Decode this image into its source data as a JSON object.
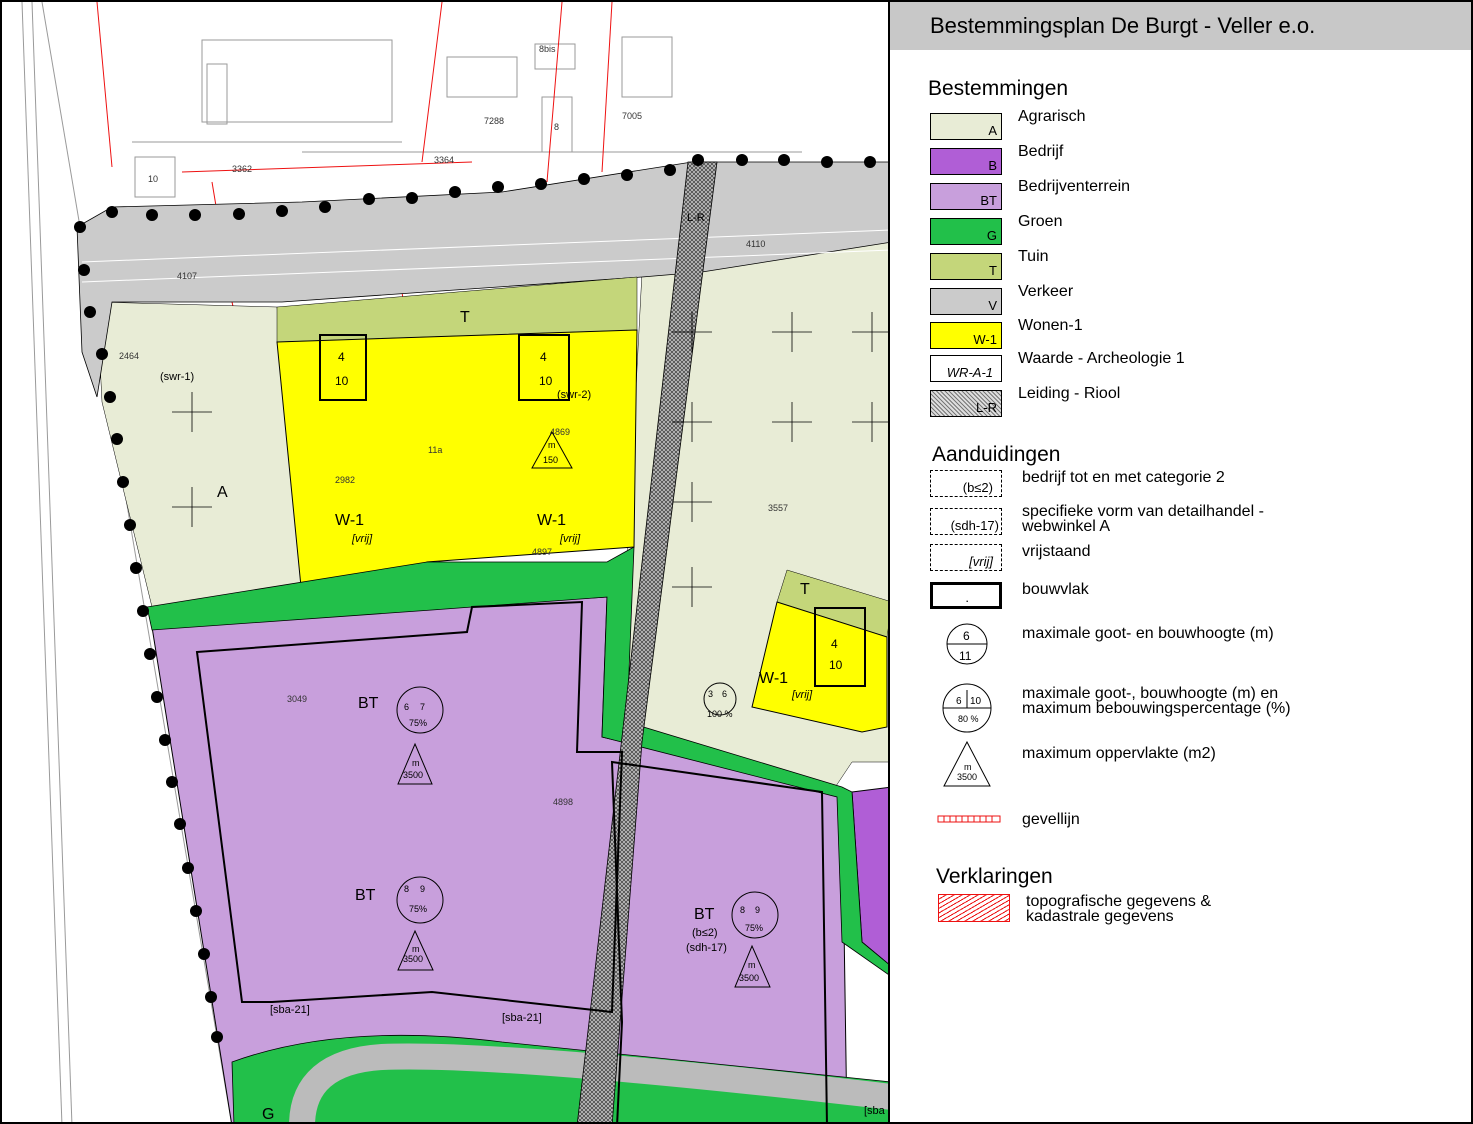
{
  "title": "Bestemmingsplan  De Burgt - Veller e.o.",
  "legend": {
    "bestemmingen_heading": "Bestemmingen",
    "bestemmingen": [
      {
        "code": "A",
        "label": "Agrarisch",
        "color": "#e8ecd6"
      },
      {
        "code": "B",
        "label": "Bedrijf",
        "color": "#b05ed6"
      },
      {
        "code": "BT",
        "label": "Bedrijventerrein",
        "color": "#c89fdc"
      },
      {
        "code": "G",
        "label": "Groen",
        "color": "#22c04a"
      },
      {
        "code": "T",
        "label": "Tuin",
        "color": "#c4d67a"
      },
      {
        "code": "V",
        "label": "Verkeer",
        "color": "#cbcbcb"
      },
      {
        "code": "W-1",
        "label": "Wonen-1",
        "color": "#ffff00"
      },
      {
        "code": "WR-A-1",
        "label": "Waarde - Archeologie 1",
        "color": "#ffffff"
      },
      {
        "code": "L-R",
        "label": "Leiding - Riool",
        "color": "#9a9a9a"
      }
    ],
    "aanduidingen_heading": "Aanduidingen",
    "aanduidingen": [
      {
        "code": "(b≤2)",
        "label": "bedrijf tot en met categorie 2"
      },
      {
        "code": "(sdh-17)",
        "label": "specifieke vorm van detailhandel -\nwebwinkel A"
      },
      {
        "code": "[vrij]",
        "label": "vrijstaand"
      },
      {
        "code": ".",
        "label": "bouwvlak"
      },
      {
        "code": "6 / 11",
        "label": "maximale goot- en bouwhoogte (m)"
      },
      {
        "code": "6 10 / 80 %",
        "label": "maximale goot-, bouwhoogte (m) en\nmaximum bebouwingspercentage (%)"
      },
      {
        "code": "m / 3500",
        "label": "maximum oppervlakte (m2)"
      },
      {
        "code": "",
        "label": "gevellijn"
      }
    ],
    "verklaringen_heading": "Verklaringen",
    "verklaringen": [
      {
        "label": "topografische gegevens &\nkadastrale gegevens"
      }
    ]
  },
  "map": {
    "labels": {
      "a": "A",
      "t1": "T",
      "t2": "T",
      "g": "G",
      "w1a": "W-1",
      "w1b": "W-1",
      "w1c": "W-1",
      "bt1": "BT",
      "bt2": "BT",
      "bt3": "BT",
      "vrij1": "[vrij]",
      "vrij2": "[vrij]",
      "vrij3": "[vrij]",
      "swr1": "(swr-1)",
      "swr2": "(swr-2)",
      "b2": "(b≤2)",
      "sdh": "(sdh-17)",
      "sba1": "[sba-21]",
      "sba2": "[sba-21]",
      "sba3": "[sba",
      "lr": "L-R"
    },
    "parcels": [
      "3362",
      "3364",
      "7288",
      "7005",
      "8bis",
      "8",
      "10",
      "4107",
      "4110",
      "2464",
      "2982",
      "11a",
      "4869",
      "4897",
      "3557",
      "3049",
      "4898"
    ],
    "heights": {
      "w_goot": "4",
      "w_bouw": "10",
      "bt1_goot": "6",
      "bt1_bouw": "7",
      "bt1_pct": "75%",
      "bt2_goot": "8",
      "bt2_bouw": "9",
      "bt2_pct": "75%",
      "bt3_goot": "8",
      "bt3_bouw": "9",
      "bt3_pct": "75%",
      "small_goot": "3",
      "small_bouw": "6",
      "small_pct": "100 %",
      "area_unit": "m",
      "area": "3500",
      "area_w": "150"
    }
  }
}
